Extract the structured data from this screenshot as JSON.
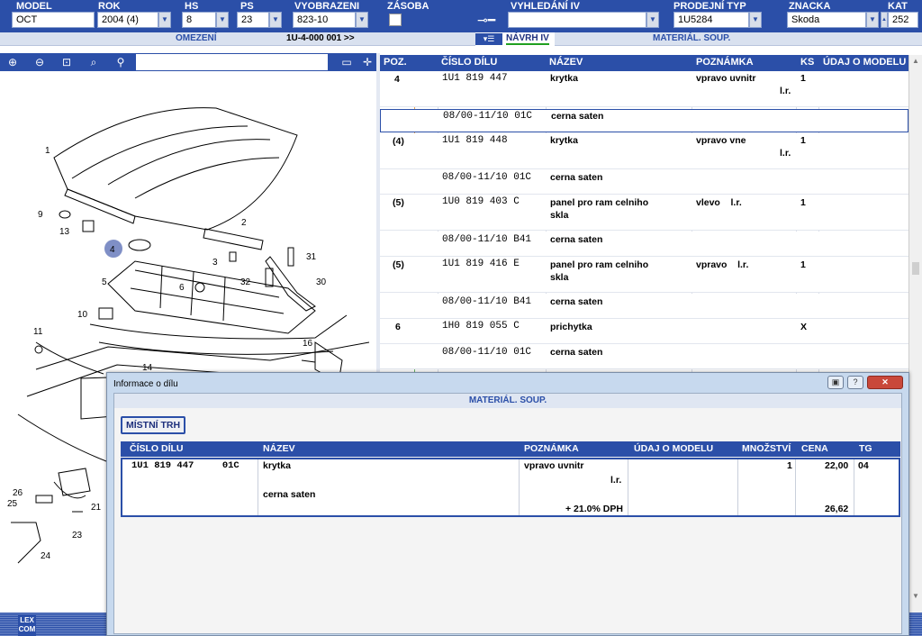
{
  "filters": {
    "model": {
      "label": "MODEL",
      "value": "OCT"
    },
    "rok": {
      "label": "ROK",
      "value": "2004 (4)"
    },
    "hs": {
      "label": "HS",
      "value": "8"
    },
    "ps": {
      "label": "PS",
      "value": "23"
    },
    "vyobrazeni": {
      "label": "VYOBRAZENI",
      "value": "823-10"
    },
    "zasoba": {
      "label": "ZÁSOBA"
    },
    "vyhledani": {
      "label": "VYHLEDÁNÍ IV",
      "value": ""
    },
    "prodejni_typ": {
      "label": "PRODEJNÍ TYP",
      "value": "1U5284"
    },
    "znacka": {
      "label": "ZNACKA",
      "value": "Skoda"
    },
    "kat": {
      "label": "KAT",
      "value": "252"
    }
  },
  "subbar": {
    "omezeni": "OMEZENÍ",
    "code": "1U-4-000 001 >>",
    "navrh": "NÁVRH IV",
    "material": "MATERIÁL. SOUP."
  },
  "table": {
    "headers": [
      "POZ.",
      "",
      "ČÍSLO DÍLU",
      "NÁZEV",
      "POZNÁMKA",
      "KS",
      "ÚDAJ O MODELU"
    ],
    "rows": [
      {
        "poz": "4",
        "cislo": "1U1 819 447",
        "nazev": "krytka",
        "poznamka": "vpravo uvnitr",
        "poznamka2": "l.r.",
        "ks": "1"
      },
      {
        "poz": "",
        "cislo": "08/00-11/10 01C",
        "nazev": "cerna saten",
        "poznamka": "",
        "poznamka2": "",
        "ks": ""
      },
      {
        "poz": "(4)",
        "cislo": "1U1 819 448",
        "nazev": "krytka",
        "poznamka": "vpravo vne",
        "poznamka2": "l.r.",
        "ks": "1"
      },
      {
        "poz": "",
        "cislo": "08/00-11/10 01C",
        "nazev": "cerna saten",
        "poznamka": "",
        "poznamka2": "",
        "ks": ""
      },
      {
        "poz": "(5)",
        "cislo": "1U0 819 403 C",
        "nazev": "panel pro ram celniho",
        "nazev2": "skla",
        "poznamka": "vlevo    l.r.",
        "poznamka2": "",
        "ks": "1"
      },
      {
        "poz": "",
        "cislo": "08/00-11/10 B41",
        "nazev": "cerna saten",
        "poznamka": "",
        "poznamka2": "",
        "ks": ""
      },
      {
        "poz": "(5)",
        "cislo": "1U1 819 416 E",
        "nazev": "panel pro ram celniho",
        "nazev2": "skla",
        "poznamka": "vpravo    l.r.",
        "poznamka2": "",
        "ks": "1"
      },
      {
        "poz": "",
        "cislo": "08/00-11/10 B41",
        "nazev": "cerna saten",
        "poznamka": "",
        "poznamka2": "",
        "ks": ""
      },
      {
        "poz": "6",
        "cislo": "1H0 819 055 C",
        "nazev": "prichytka",
        "poznamka": "",
        "poznamka2": "",
        "ks": "X"
      },
      {
        "poz": "",
        "cislo": "08/00-11/10 01C",
        "nazev": "cerna saten",
        "poznamka": "",
        "poznamka2": "",
        "ks": ""
      }
    ]
  },
  "diagram": {
    "labels": [
      "1",
      "2",
      "3",
      "4",
      "5",
      "6",
      "9",
      "10",
      "11",
      "13",
      "14",
      "16",
      "21",
      "23",
      "24",
      "25",
      "26",
      "30",
      "31",
      "32"
    ]
  },
  "dialog": {
    "title": "Informace o dílu",
    "header": "MATERIÁL. SOUP.",
    "tab": "MÍSTNÍ TRH",
    "columns": [
      "ČÍSLO DÍLU",
      "NÁZEV",
      "POZNÁMKA",
      "ÚDAJ O MODELU",
      "MNOŽSTVÍ",
      "CENA",
      "TG"
    ],
    "row": {
      "cislo": "1U1 819 447     01C",
      "nazev": "krytka",
      "nazev2": "cerna saten",
      "poznamka": "vpravo uvnitr",
      "poznamka2": "l.r.",
      "dph": "+ 21.0% DPH",
      "mnozstvi": "1",
      "cena": "22,00",
      "cena_dph": "26,62",
      "tg": "04"
    }
  },
  "logo": "LEX COM",
  "colors": {
    "accent": "#2b4fa8",
    "selection": "#2b4fa8",
    "dialog_frame": "#c7d9ee"
  }
}
